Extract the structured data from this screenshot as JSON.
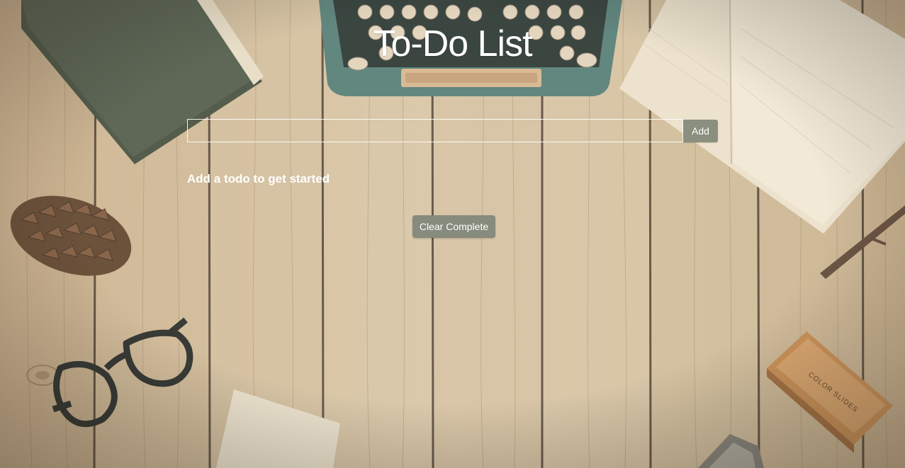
{
  "page": {
    "title": "To-Do List"
  },
  "form": {
    "input_value": "",
    "input_placeholder": "",
    "add_label": "Add"
  },
  "list": {
    "empty_message": "Add a todo to get started",
    "items": []
  },
  "actions": {
    "clear_complete_label": "Clear Complete"
  },
  "colors": {
    "background_wood": "#cdb797",
    "button": "#8a8f7f",
    "text": "#ffffff"
  },
  "background_objects": [
    "book",
    "typewriter",
    "notebook",
    "pine-cone",
    "glasses",
    "color-slides-box",
    "paper-card",
    "twig"
  ]
}
